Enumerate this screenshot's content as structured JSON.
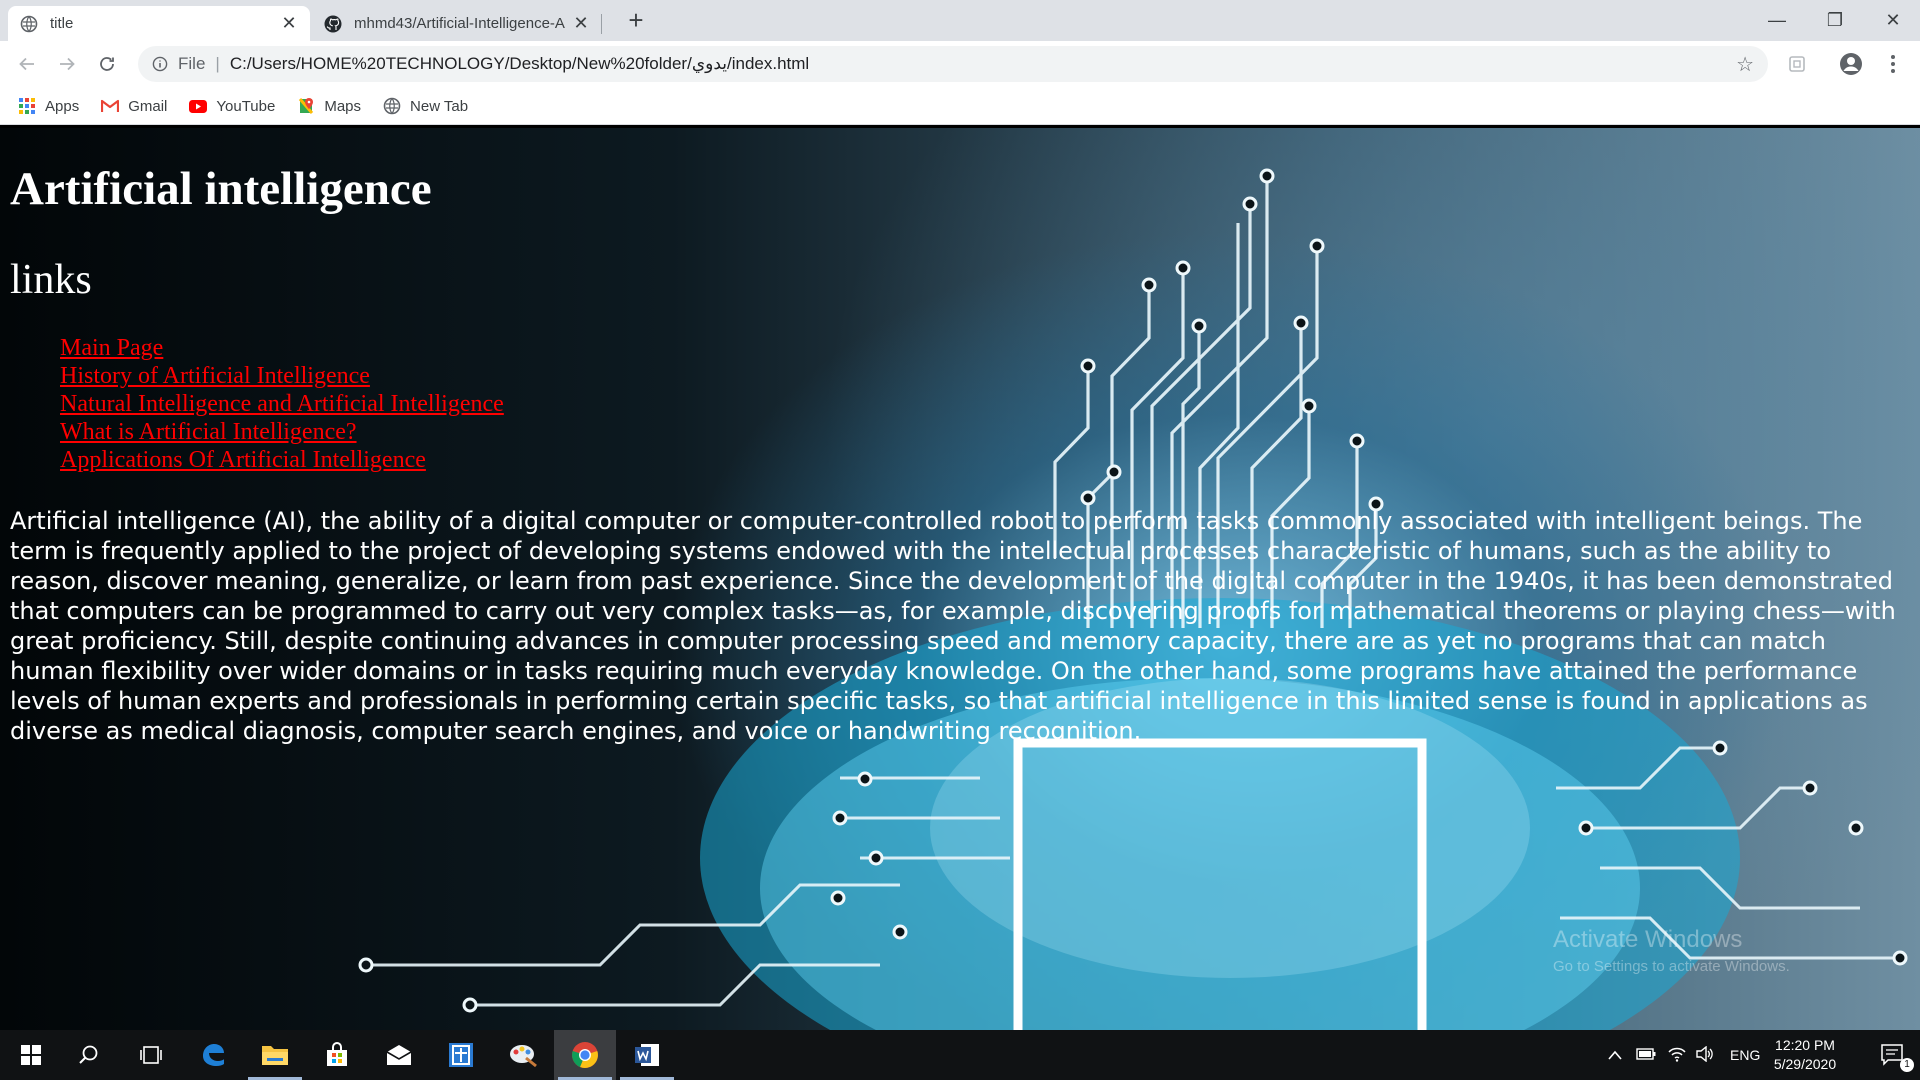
{
  "browser": {
    "tabs": [
      {
        "title": "title",
        "active": true
      },
      {
        "title": "mhmd43/Artificial-Intelligence-A",
        "active": false
      }
    ],
    "new_tab_symbol": "+",
    "window_controls": {
      "minimize": "—",
      "restore": "❐",
      "close": "✕"
    },
    "address": {
      "scheme_label": "File",
      "url": "C:/Users/HOME%20TECHNOLOGY/Desktop/New%20folder/يدوي/index.html"
    },
    "bookmarks": [
      {
        "label": "Apps",
        "icon": "apps-grid-icon"
      },
      {
        "label": "Gmail",
        "icon": "gmail-icon"
      },
      {
        "label": "YouTube",
        "icon": "youtube-icon"
      },
      {
        "label": "Maps",
        "icon": "maps-icon"
      },
      {
        "label": "New Tab",
        "icon": "globe-icon"
      }
    ]
  },
  "page": {
    "heading": "Artificial intelligence",
    "subheading": "links",
    "links": [
      "Main Page",
      "History of Artificial Intelligence",
      "Natural Intelligence and Artificial Intelligence",
      "What is Artificial Intelligence?",
      "Applications Of Artificial Intelligence"
    ],
    "paragraph": "Artificial intelligence (AI), the ability of a digital computer or computer-controlled robot to perform tasks commonly associated with intelligent beings. The term is frequently applied to the project of developing systems endowed with the intellectual processes characteristic of humans, such as the ability to reason, discover meaning, generalize, or learn from past experience. Since the development of the digital computer in the 1940s, it has been demonstrated that computers can be programmed to carry out very complex tasks—as, for example, discovering proofs for mathematical theorems or playing chess—with great proficiency. Still, despite continuing advances in computer processing speed and memory capacity, there are as yet no programs that can match human flexibility over wider domains or in tasks requiring much everyday knowledge. On the other hand, some programs have attained the performance levels of human experts and professionals in performing certain specific tasks, so that artificial intelligence in this limited sense is found in applications as diverse as medical diagnosis, computer search engines, and voice or handwriting recognition.",
    "watermark_line1": "Activate Windows",
    "watermark_line2": "Go to Settings to activate Windows."
  },
  "taskbar": {
    "items": [
      "windows-start-icon",
      "search-icon",
      "task-view-icon",
      "edge-icon",
      "file-explorer-icon",
      "store-icon",
      "mail-icon",
      "calculator-icon",
      "paint-icon",
      "chrome-icon",
      "word-icon"
    ],
    "tray_language": "ENG",
    "clock_time": "12:20 PM",
    "clock_date": "5/29/2020",
    "notification_count": "1"
  },
  "colors": {
    "link": "#ff0000",
    "page_text": "#ffffff",
    "accent_cyan": "#5fd3f3",
    "taskbar": "#101214"
  }
}
